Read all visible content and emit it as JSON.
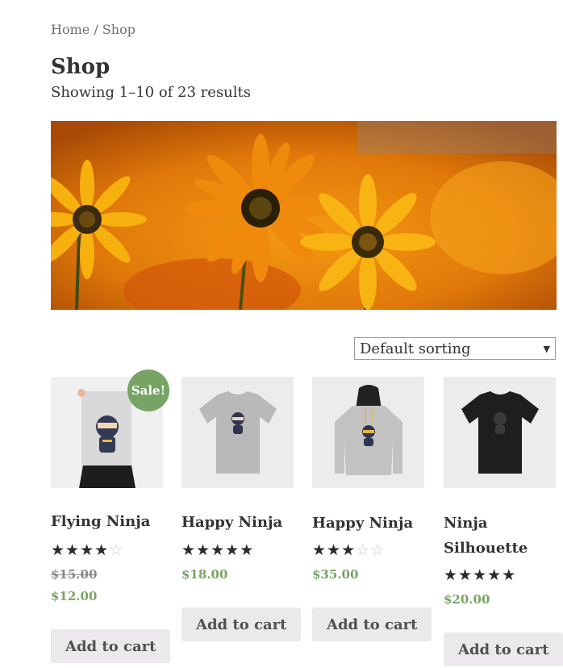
{
  "breadcrumb": {
    "home": "Home",
    "sep": " / ",
    "current": "Shop"
  },
  "page": {
    "title": "Shop",
    "result_count": "Showing 1–10 of 23 results"
  },
  "sorting": {
    "selected": "Default sorting"
  },
  "products": [
    {
      "name": "Flying Ninja",
      "rating": 4,
      "old_price": "$15.00",
      "price": "$12.00",
      "badge": "Sale!",
      "button": "Add to cart"
    },
    {
      "name": "Happy Ninja",
      "rating": 5,
      "price": "$18.00",
      "button": "Add to cart"
    },
    {
      "name": "Happy Ninja",
      "rating": 3,
      "price": "$35.00",
      "button": "Add to cart"
    },
    {
      "name": "Ninja Silhouette",
      "rating": 5,
      "price": "$20.00",
      "button": "Add to cart"
    }
  ],
  "colors": {
    "accent": "#77a464",
    "thumb_bg": "#ececec",
    "button_bg": "#ebe9eb"
  }
}
